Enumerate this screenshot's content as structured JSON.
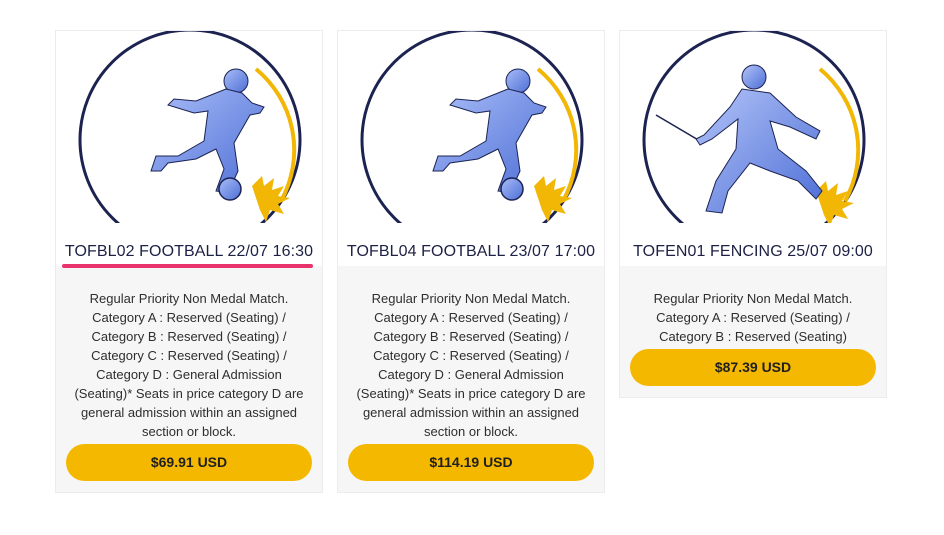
{
  "events": [
    {
      "title": "TOFBL02 FOOTBALL 22/07 16:30",
      "description": "Regular Priority Non Medal Match. Category A : Reserved (Seating) / Category B : Reserved (Seating) / Category C : Reserved (Seating) / Category D : General Admission (Seating)* Seats in price category D are general admission within an assigned section or block.",
      "price": "$69.91 USD",
      "icon": "football-player-icon"
    },
    {
      "title": "TOFBL04 FOOTBALL 23/07 17:00",
      "description": "Regular Priority Non Medal Match. Category A : Reserved (Seating) / Category B : Reserved (Seating) / Category C : Reserved (Seating) / Category D : General Admission (Seating)* Seats in price category D are general admission within an assigned section or block.",
      "price": "$114.19 USD",
      "icon": "football-player-icon"
    },
    {
      "title": "TOFEN01 FENCING 25/07 09:00",
      "description": "Regular Priority Non Medal Match. Category A : Reserved (Seating) / Category B : Reserved (Seating)",
      "price": "$87.39 USD",
      "icon": "fencer-icon"
    }
  ],
  "colors": {
    "button": "#f5b801",
    "title_text": "#1c2145",
    "highlight_underline": "#e8336d",
    "card_bg": "#f6f6f7",
    "figure_blue": "#6f8fe6",
    "ring_navy": "#1c2351",
    "ring_gold": "#f2b705"
  }
}
